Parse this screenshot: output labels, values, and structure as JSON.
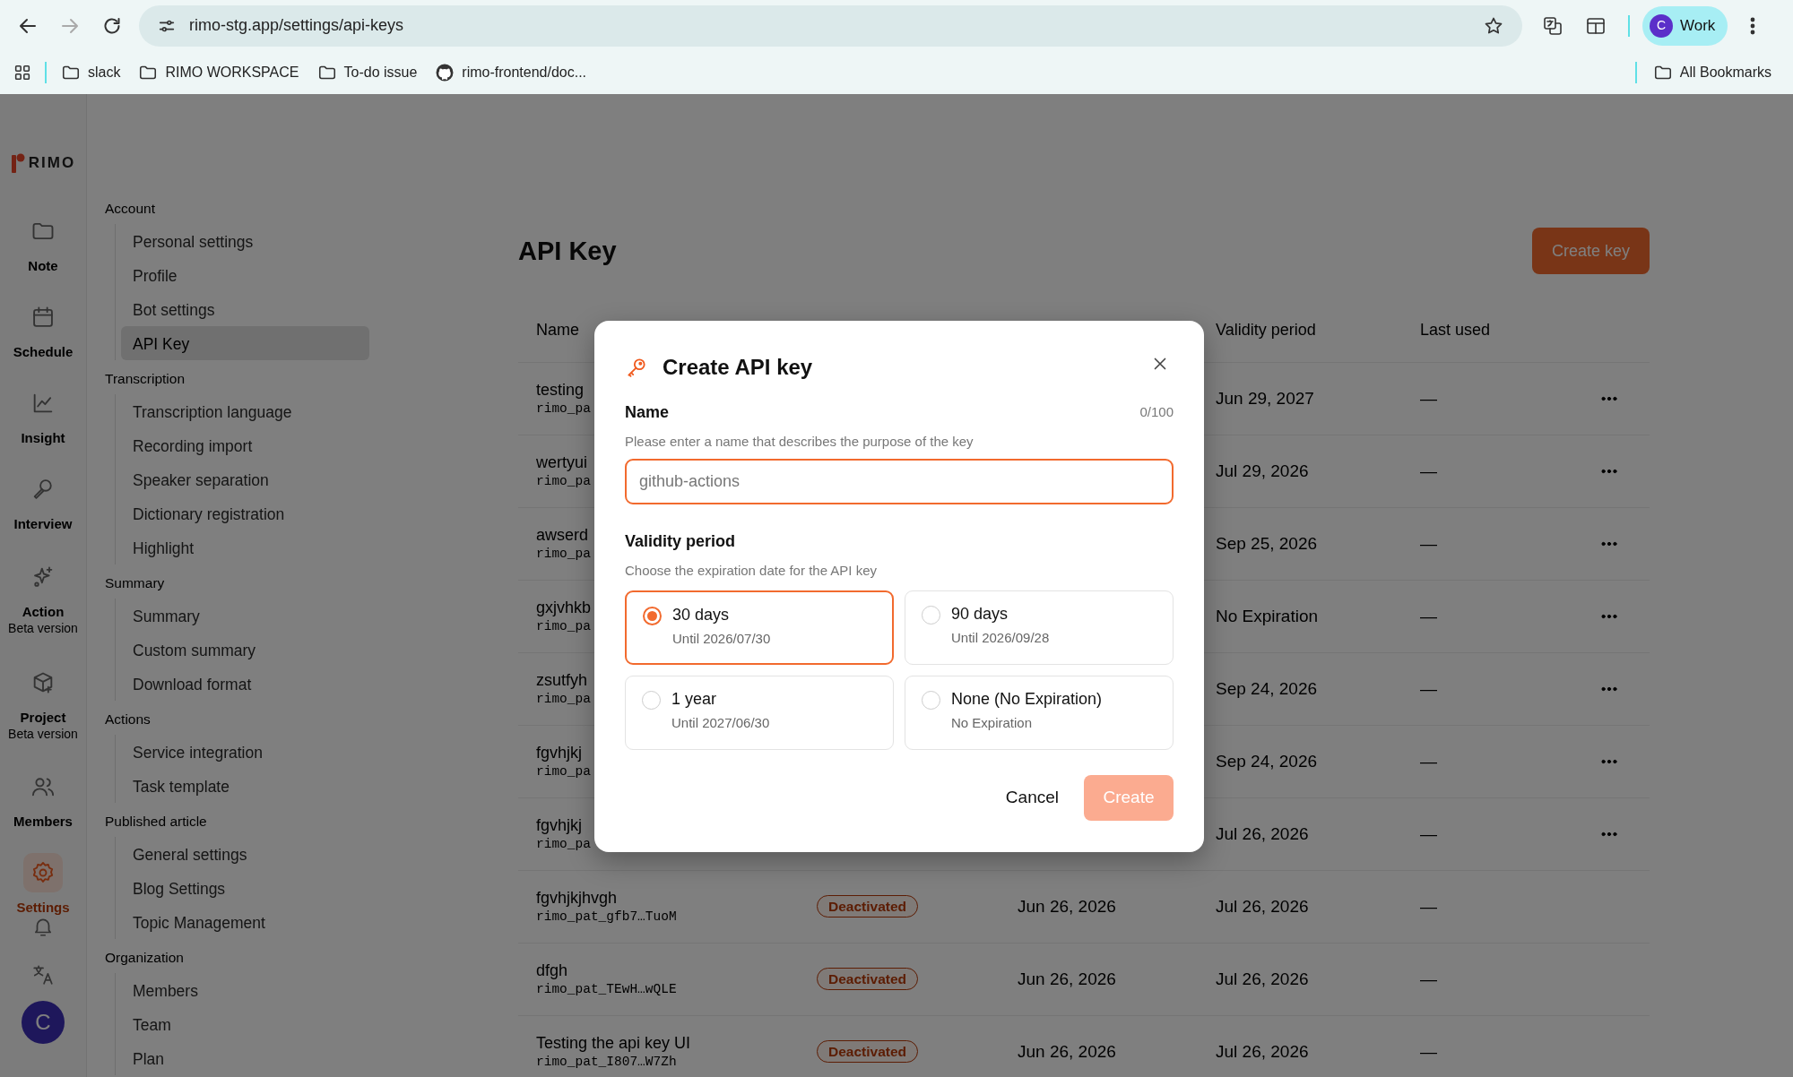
{
  "browser": {
    "url": "rimo-stg.app/settings/api-keys",
    "forward_disabled": true,
    "profile_initial": "C",
    "profile_name": "Work",
    "bookmarks": [
      {
        "kind": "folder",
        "label": "slack"
      },
      {
        "kind": "folder",
        "label": "RIMO WORKSPACE"
      },
      {
        "kind": "folder",
        "label": "To-do issue"
      },
      {
        "kind": "repo",
        "label": "rimo-frontend/doc..."
      }
    ],
    "all_bookmarks": "All Bookmarks"
  },
  "app": {
    "logo": "RIMO",
    "avatar_initial": "C",
    "rail": [
      {
        "kind": "note",
        "label": "Note",
        "selected": false
      },
      {
        "kind": "schedule",
        "label": "Schedule",
        "selected": false
      },
      {
        "kind": "insight",
        "label": "Insight",
        "selected": false
      },
      {
        "kind": "interview",
        "label": "Interview",
        "selected": false
      },
      {
        "kind": "action",
        "label": "Action",
        "sublabel": "Beta version",
        "selected": false
      },
      {
        "kind": "project",
        "label": "Project",
        "sublabel": "Beta version",
        "selected": false
      },
      {
        "kind": "members",
        "label": "Members",
        "selected": false
      },
      {
        "kind": "settings",
        "label": "Settings",
        "selected": true
      }
    ]
  },
  "settings_nav": [
    {
      "heading": "Account",
      "items": [
        {
          "label": "Personal settings",
          "selected": false
        },
        {
          "label": "Profile",
          "selected": false
        },
        {
          "label": "Bot settings",
          "selected": false
        },
        {
          "label": "API Key",
          "selected": true
        }
      ]
    },
    {
      "heading": "Transcription",
      "items": [
        {
          "label": "Transcription language",
          "selected": false
        },
        {
          "label": "Recording import",
          "selected": false
        },
        {
          "label": "Speaker separation",
          "selected": false
        },
        {
          "label": "Dictionary registration",
          "selected": false
        },
        {
          "label": "Highlight",
          "selected": false
        }
      ]
    },
    {
      "heading": "Summary",
      "items": [
        {
          "label": "Summary",
          "selected": false
        },
        {
          "label": "Custom summary",
          "selected": false
        },
        {
          "label": "Download format",
          "selected": false
        }
      ]
    },
    {
      "heading": "Actions",
      "items": [
        {
          "label": "Service integration",
          "selected": false
        },
        {
          "label": "Task template",
          "selected": false
        }
      ]
    },
    {
      "heading": "Published article",
      "items": [
        {
          "label": "General settings",
          "selected": false
        },
        {
          "label": "Blog Settings",
          "selected": false
        },
        {
          "label": "Topic Management",
          "selected": false
        }
      ]
    },
    {
      "heading": "Organization",
      "items": [
        {
          "label": "Members",
          "selected": false
        },
        {
          "label": "Team",
          "selected": false
        },
        {
          "label": "Plan",
          "selected": false
        }
      ]
    }
  ],
  "page": {
    "title": "API Key",
    "create_button": "Create key"
  },
  "table": {
    "columns": [
      "Name",
      "Validity period",
      "Last used"
    ],
    "rows": [
      {
        "name": "testing",
        "key": "rimo_pa",
        "validity": "Jun 29, 2027",
        "last_used": "—",
        "menu": true
      },
      {
        "name": "wertyui",
        "key": "rimo_pa",
        "validity": "Jul 29, 2026",
        "last_used": "—",
        "menu": true
      },
      {
        "name": "awserd",
        "key": "rimo_pa",
        "validity": "Sep 25, 2026",
        "last_used": "—",
        "menu": true
      },
      {
        "name": "gxjvhkb",
        "key": "rimo_pa",
        "validity": "No Expiration",
        "last_used": "—",
        "menu": true
      },
      {
        "name": "zsutfyh",
        "key": "rimo_pa",
        "validity": "Sep 24, 2026",
        "last_used": "—",
        "menu": true
      },
      {
        "name": "fgvhjkj",
        "key": "rimo_pa",
        "validity": "Sep 24, 2026",
        "last_used": "—",
        "menu": true
      },
      {
        "name": "fgvhjkj",
        "key": "rimo_pa",
        "validity": "Jul 26, 2026",
        "last_used": "—",
        "menu": true
      },
      {
        "name": "fgvhjkjhvgh",
        "key": "rimo_pat_gfb7…TuoM",
        "status": "Deactivated",
        "created": "Jun 26, 2026",
        "validity": "Jul 26, 2026",
        "last_used": "—",
        "menu": false
      },
      {
        "name": "dfgh",
        "key": "rimo_pat_TEwH…wQLE",
        "status": "Deactivated",
        "created": "Jun 26, 2026",
        "validity": "Jul 26, 2026",
        "last_used": "—",
        "menu": false
      },
      {
        "name": "Testing the api key UI",
        "key": "rimo_pat_I807…W7Zh",
        "status": "Deactivated",
        "created": "Jun 26, 2026",
        "validity": "Jul 26, 2026",
        "last_used": "—",
        "menu": false
      }
    ]
  },
  "dialog": {
    "title": "Create API key",
    "name_label": "Name",
    "counter": "0/100",
    "name_hint": "Please enter a name that describes the purpose of the key",
    "placeholder": "github-actions",
    "validity_label": "Validity period",
    "validity_hint": "Choose the expiration date for the API key",
    "options": [
      {
        "title": "30 days",
        "subtitle": "Until 2026/07/30",
        "selected": true
      },
      {
        "title": "90 days",
        "subtitle": "Until 2026/09/28",
        "selected": false
      },
      {
        "title": "1 year",
        "subtitle": "Until 2027/06/30",
        "selected": false
      },
      {
        "title": "None (No Expiration)",
        "subtitle": "No Expiration",
        "selected": false
      }
    ],
    "cancel": "Cancel",
    "create": {
      "label": "Create",
      "disabled": true
    }
  }
}
